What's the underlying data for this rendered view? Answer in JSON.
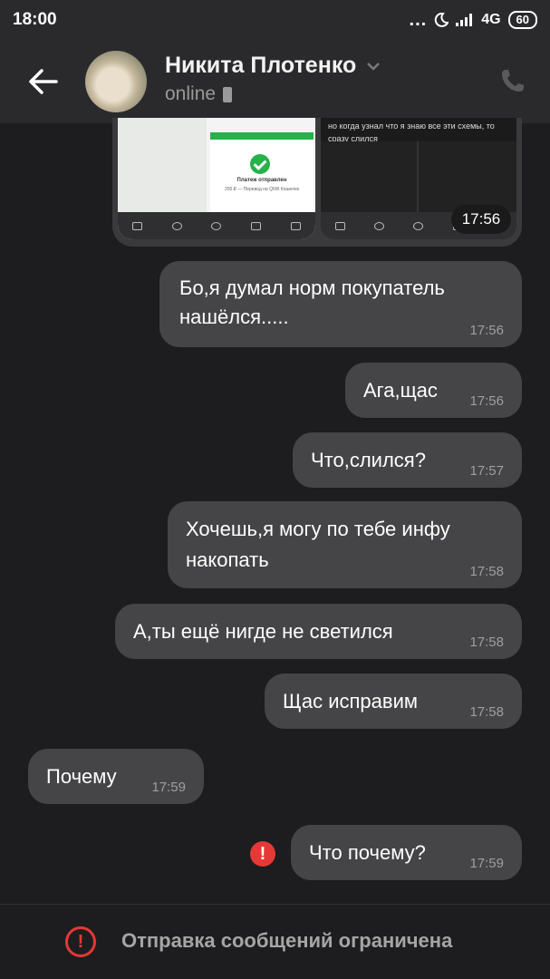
{
  "status_bar": {
    "time": "18:00",
    "dots": "...",
    "network": "4G",
    "battery": "60"
  },
  "header": {
    "contact_name": "Никита Плотенко",
    "status": "online"
  },
  "attachment": {
    "time": "17:56",
    "left_title": "Платеж отправлен",
    "left_sub": "200 ₽ — Перевод на QIWI Кошелек",
    "right_text": "но когда узнал что я знаю все эти схемы, то сразу слился"
  },
  "messages": [
    {
      "side": "out",
      "text_lines": [
        "Бо,я думал норм покупатель",
        "нашёлся....."
      ],
      "time": "17:56"
    },
    {
      "side": "out",
      "text_lines": [
        "Ага,щас"
      ],
      "time": "17:56"
    },
    {
      "side": "out",
      "text_lines": [
        "Что,слился?"
      ],
      "time": "17:57"
    },
    {
      "side": "out",
      "text_lines": [
        "Хочешь,я могу по тебе инфу",
        "накопать"
      ],
      "time": "17:58"
    },
    {
      "side": "out",
      "text_lines": [
        "А,ты ещё нигде не светился"
      ],
      "time": "17:58"
    },
    {
      "side": "out",
      "text_lines": [
        "Щас исправим"
      ],
      "time": "17:58"
    },
    {
      "side": "in",
      "text_lines": [
        "Почему"
      ],
      "time": "17:59"
    },
    {
      "side": "out",
      "text_lines": [
        "Что почему?"
      ],
      "time": "17:59",
      "error": "!"
    }
  ],
  "restriction": {
    "icon": "!",
    "text": "Отправка сообщений ограничена"
  },
  "colors": {
    "bubble": "#454547",
    "background": "#1d1d1f",
    "error": "#e53935"
  }
}
